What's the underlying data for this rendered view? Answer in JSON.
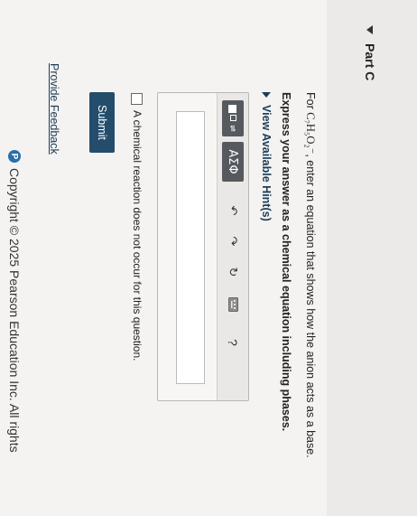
{
  "part": {
    "label": "Part C"
  },
  "question": {
    "prefix": "For ",
    "formula": "C₇H₅O₂⁻",
    "suffix": ", enter an equation that shows how the anion acts as a base."
  },
  "instruction": "Express your answer as a chemical equation including phases.",
  "hints_label": "View Available Hint(s)",
  "toolbar": {
    "greek_label": "ΑΣΦ",
    "undo_glyph": "↶",
    "redo_glyph": "↷",
    "reset_glyph": "↻",
    "help_label": "?"
  },
  "answer": {
    "value": ""
  },
  "no_reaction_label": "A chemical reaction does not occur for this question.",
  "submit_label": "Submit",
  "feedback_label": "Provide Feedback",
  "copyright": "Copyright © 2025 Pearson Education Inc. All rights",
  "logo_letter": "P"
}
